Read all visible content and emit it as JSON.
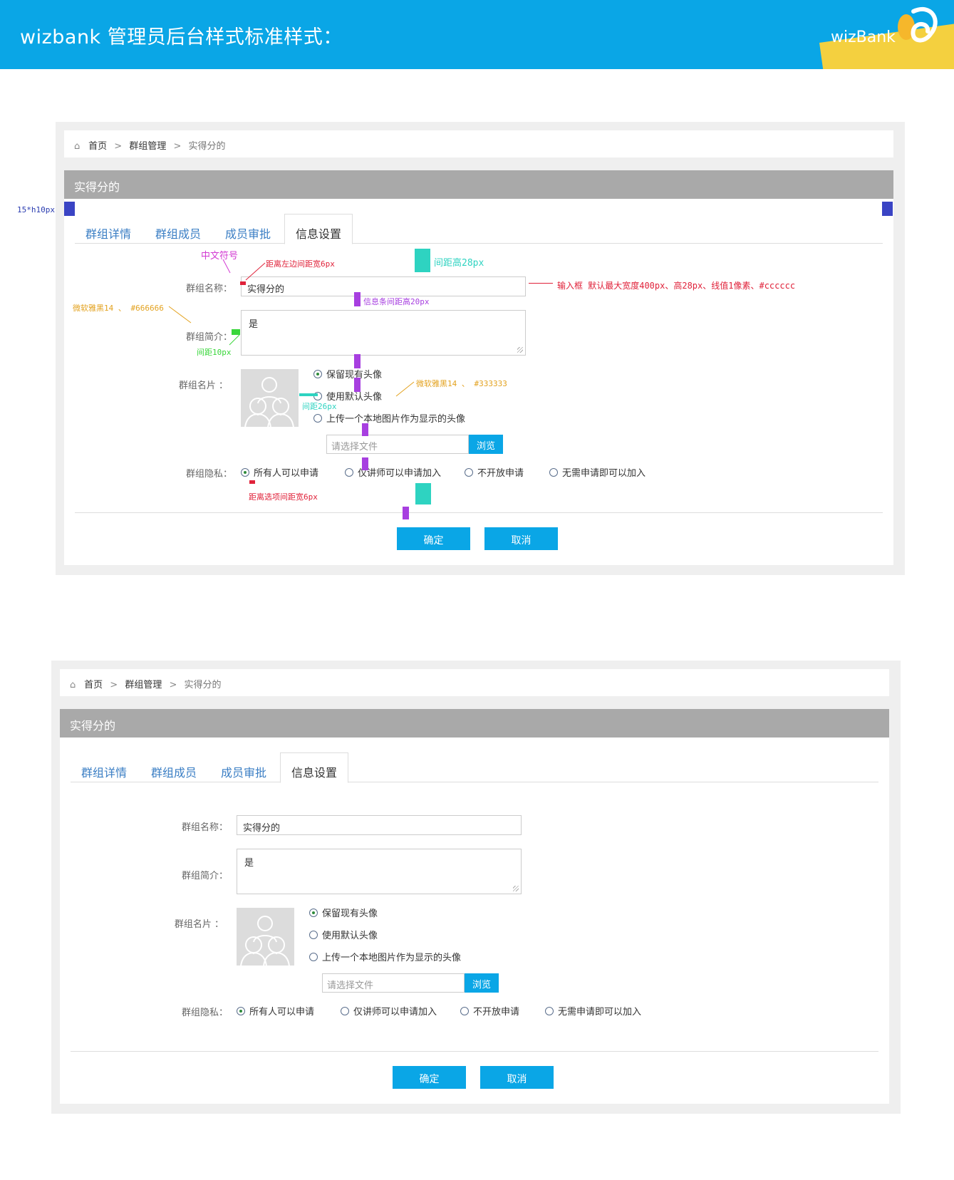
{
  "banner": {
    "title": "wizbank 管理员后台样式标准样式：",
    "brand": "wizBank"
  },
  "page": {
    "breadcrumb": {
      "home": "首页",
      "group_mgmt": "群组管理",
      "current": "实得分的"
    },
    "title": "实得分的",
    "tabs": [
      "群组详情",
      "群组成员",
      "成员审批",
      "信息设置"
    ],
    "active_tab": "信息设置",
    "form": {
      "name_label": "群组名称：",
      "name_value": "实得分的",
      "intro_label": "群组简介：",
      "intro_value": "是",
      "card_label": "群组名片 ：",
      "card_options": [
        "保留现有头像",
        "使用默认头像",
        "上传一个本地图片作为显示的头像"
      ],
      "file_placeholder": "请选择文件",
      "browse_label": "浏览",
      "privacy_label": "群组隐私：",
      "privacy_options": [
        "所有人可以申请",
        "仅讲师可以申请加入",
        "不开放申请",
        "无需申请即可以加入"
      ],
      "confirm_label": "确定",
      "cancel_label": "取消"
    }
  },
  "annotations": {
    "side_block": "15*h10px",
    "cn_symbol": "中文符号",
    "left_gap": "距离左边间距宽6px",
    "gap_28": "间距高28px",
    "input_spec": "输入框 默认最大宽度400px、高28px、线值1像素、#cccccc",
    "row_gap": "信息条间距高20px",
    "label_font": "微软雅黑14 、 #666666",
    "gap_10": "间距10px",
    "option_font": "微软雅黑14 、 #333333",
    "gap_26": "间距26px",
    "option_gap": "距离选项间距宽6px"
  },
  "colors": {
    "accent": "#0aa6e6",
    "title_bar": "#a9a9a9",
    "link": "#3a7ec4",
    "border": "#cccccc"
  }
}
